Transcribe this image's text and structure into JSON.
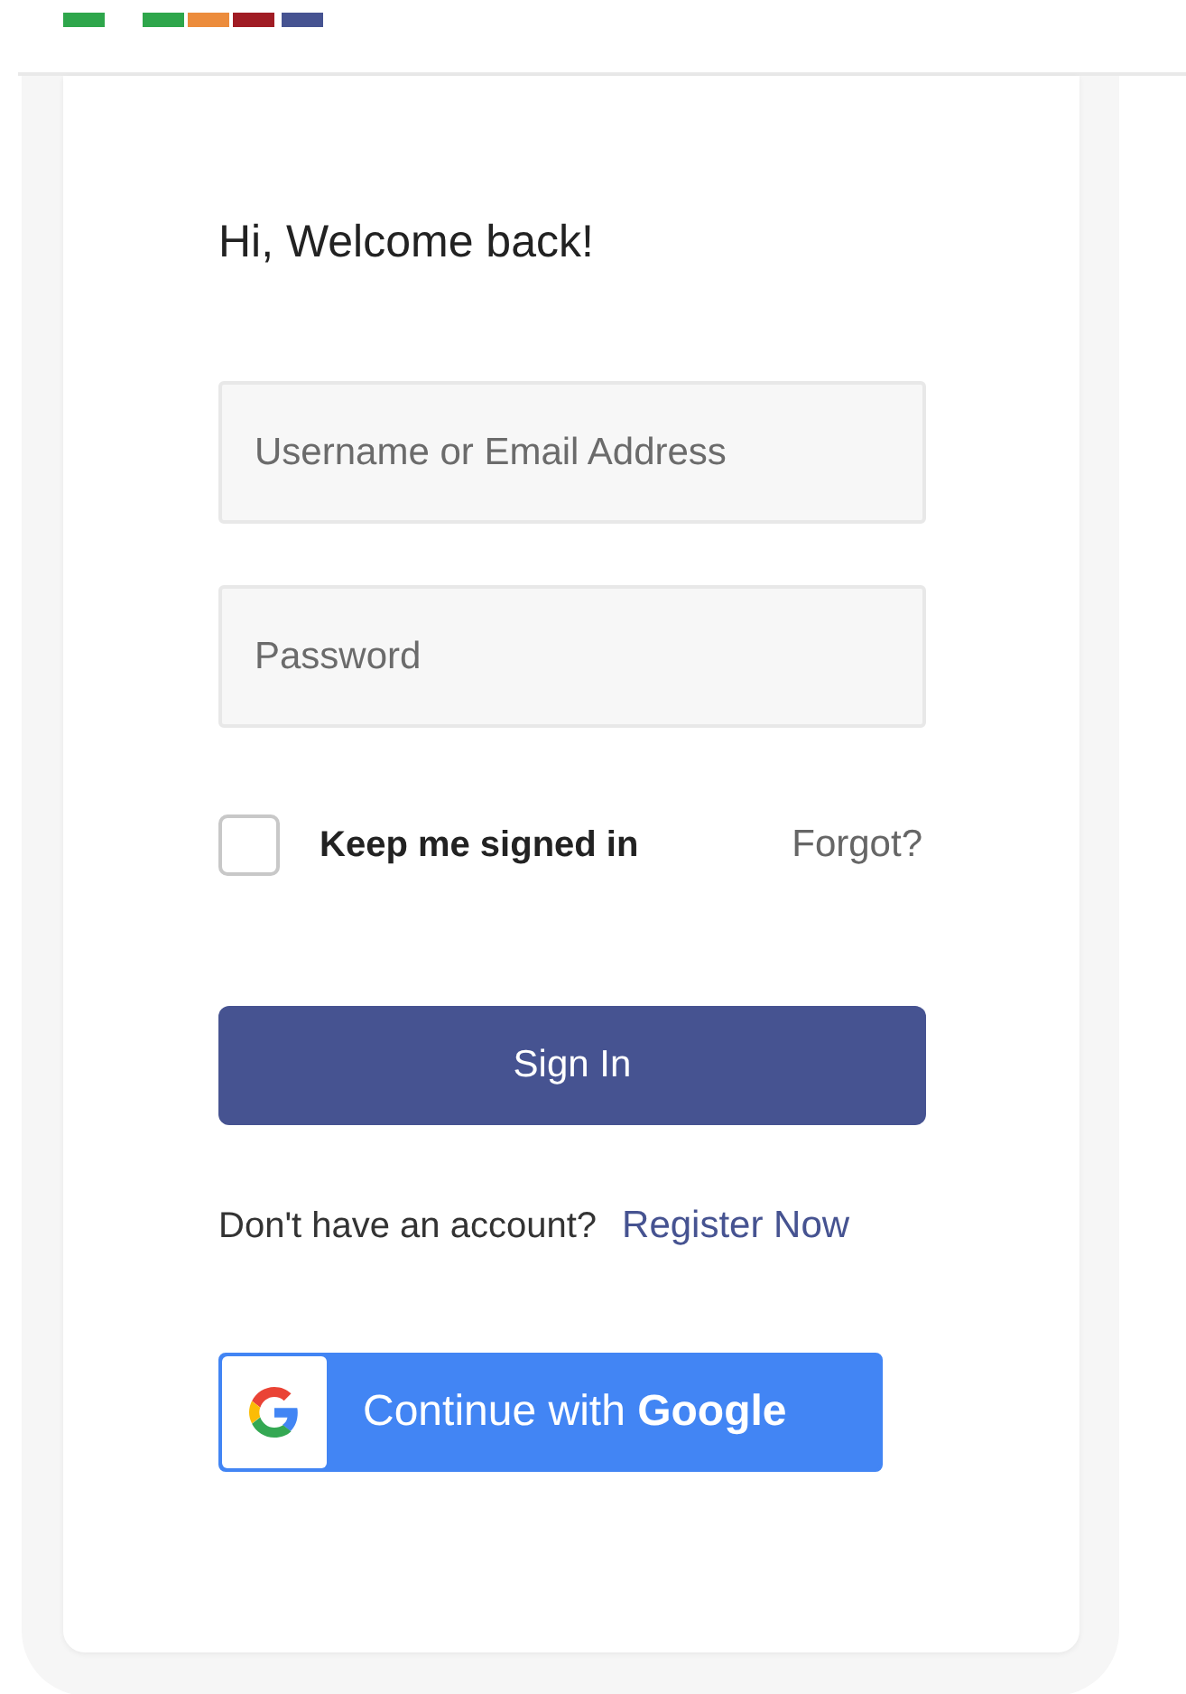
{
  "heading": "Hi, Welcome back!",
  "fields": [
    {
      "placeholder": "Username or Email Address"
    },
    {
      "placeholder": "Password"
    }
  ],
  "remember": {
    "label": "Keep me signed in",
    "checked": false
  },
  "forgot_link": "Forgot?",
  "submit_button": "Sign In",
  "register": {
    "prompt": "Don't have an account?",
    "link": "Register Now"
  },
  "google_button": "Continue with **Google**"
}
